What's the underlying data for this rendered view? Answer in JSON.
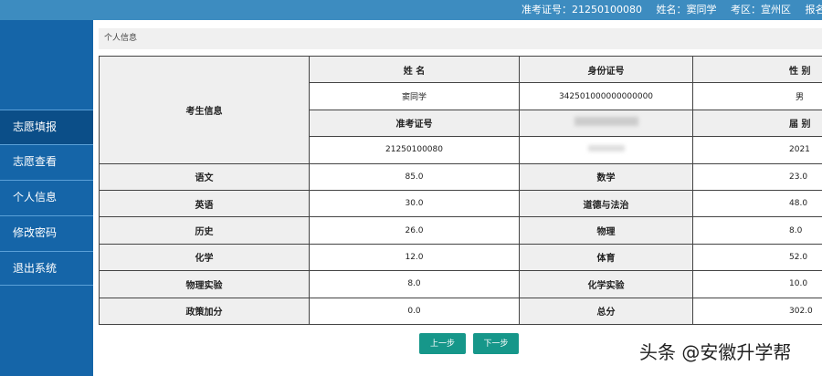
{
  "header": {
    "exam_no": "准考证号：21250100080",
    "name": "姓名：窦同学",
    "district": "考区：宣州区",
    "site": "报名点：宣"
  },
  "sidebar": {
    "items": [
      {
        "label": "志愿填报"
      },
      {
        "label": "志愿查看"
      },
      {
        "label": "个人信息"
      },
      {
        "label": "修改密码"
      },
      {
        "label": "退出系统"
      }
    ]
  },
  "breadcrumb": "个人信息",
  "student": {
    "section": "考生信息",
    "name_h": "姓 名",
    "id_h": "身份证号",
    "gender_h": "性 别",
    "name": "窦同学",
    "id": "342501000000000000",
    "gender": "男",
    "exam_h": "准考证号",
    "year_h": "届 别",
    "exam_no": "21250100080",
    "year": "2021"
  },
  "scores": [
    {
      "a": "语文",
      "av": "85.0",
      "b": "数学",
      "bv": "23.0"
    },
    {
      "a": "英语",
      "av": "30.0",
      "b": "道德与法治",
      "bv": "48.0"
    },
    {
      "a": "历史",
      "av": "26.0",
      "b": "物理",
      "bv": "8.0"
    },
    {
      "a": "化学",
      "av": "12.0",
      "b": "体育",
      "bv": "52.0"
    },
    {
      "a": "物理实验",
      "av": "8.0",
      "b": "化学实验",
      "bv": "10.0"
    },
    {
      "a": "政策加分",
      "av": "0.0",
      "b": "总分",
      "bv": "302.0"
    }
  ],
  "buttons": {
    "prev": "上一步",
    "next": "下一步"
  },
  "watermark": "头条 @安徽升学帮"
}
